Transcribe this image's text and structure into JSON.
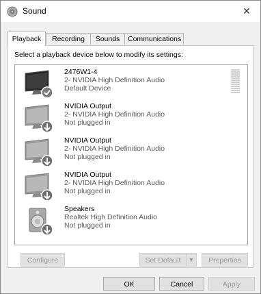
{
  "window": {
    "title": "Sound",
    "close_glyph": "✕",
    "title_icon": "speaker-icon"
  },
  "tabs": [
    {
      "label": "Playback",
      "active": true
    },
    {
      "label": "Recording",
      "active": false
    },
    {
      "label": "Sounds",
      "active": false
    },
    {
      "label": "Communications",
      "active": false
    }
  ],
  "instructions": "Select a playback device below to modify its settings:",
  "devices": [
    {
      "name": "2476W1-4",
      "description": "2- NVIDIA High Definition Audio",
      "status": "Default Device",
      "icon": "monitor-icon",
      "badge": "check-badge-icon",
      "selected": true
    },
    {
      "name": "NVIDIA Output",
      "description": "2- NVIDIA High Definition Audio",
      "status": "Not plugged in",
      "icon": "monitor-icon",
      "badge": "down-arrow-badge-icon"
    },
    {
      "name": "NVIDIA Output",
      "description": "2- NVIDIA High Definition Audio",
      "status": "Not plugged in",
      "icon": "monitor-icon",
      "badge": "down-arrow-badge-icon"
    },
    {
      "name": "NVIDIA Output",
      "description": "2- NVIDIA High Definition Audio",
      "status": "Not plugged in",
      "icon": "monitor-icon",
      "badge": "down-arrow-badge-icon"
    },
    {
      "name": "Speakers",
      "description": "Realtek High Definition Audio",
      "status": "Not plugged in",
      "icon": "speaker-device-icon",
      "badge": "down-arrow-badge-icon"
    }
  ],
  "buttons": {
    "configure": "Configure",
    "set_default": "Set Default",
    "set_default_arrow": "▼",
    "properties": "Properties",
    "ok": "OK",
    "cancel": "Cancel",
    "apply": "Apply"
  },
  "colors": {
    "window_bg": "#f0f0f0",
    "disabled_text": "#9a9a9a",
    "badge_gray": "#6e6e6e"
  }
}
